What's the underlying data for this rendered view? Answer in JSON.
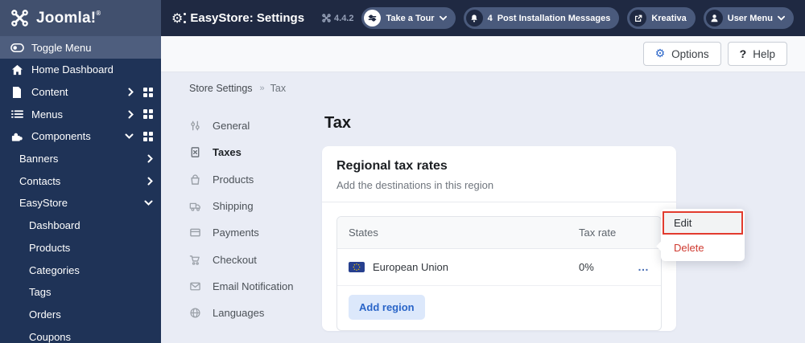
{
  "topbar": {
    "logo_text": "Joomla!",
    "logo_reg": "®",
    "app_title": "EasyStore: Settings",
    "version": "4.4.2",
    "take_a_tour": "Take a Tour",
    "messages_badge": "4",
    "messages_label": "Post Installation Messages",
    "template_name": "Kreativa",
    "user_menu": "User Menu"
  },
  "sidebar": {
    "items": [
      {
        "label": "Toggle Menu"
      },
      {
        "label": "Home Dashboard"
      },
      {
        "label": "Content"
      },
      {
        "label": "Menus"
      },
      {
        "label": "Components"
      },
      {
        "label": "Banners"
      },
      {
        "label": "Contacts"
      },
      {
        "label": "EasyStore"
      },
      {
        "label": "Dashboard"
      },
      {
        "label": "Products"
      },
      {
        "label": "Categories"
      },
      {
        "label": "Tags"
      },
      {
        "label": "Orders"
      },
      {
        "label": "Coupons"
      }
    ]
  },
  "toolbar": {
    "options": "Options",
    "help": "Help"
  },
  "breadcrumb": {
    "root": "Store Settings",
    "current": "Tax"
  },
  "settings_nav": {
    "items": [
      {
        "label": "General"
      },
      {
        "label": "Taxes"
      },
      {
        "label": "Products"
      },
      {
        "label": "Shipping"
      },
      {
        "label": "Payments"
      },
      {
        "label": "Checkout"
      },
      {
        "label": "Email Notification"
      },
      {
        "label": "Languages"
      }
    ]
  },
  "main": {
    "page_title": "Tax",
    "card": {
      "title": "Regional tax rates",
      "subtitle": "Add the destinations in this region",
      "columns": {
        "states": "States",
        "tax_rate": "Tax rate"
      },
      "rows": [
        {
          "state": "European Union",
          "tax_rate": "0%"
        }
      ],
      "add_region": "Add region",
      "row_menu_icon": "…"
    },
    "context_menu": {
      "edit": "Edit",
      "delete": "Delete"
    }
  },
  "colors": {
    "header_navy": "#1f2942",
    "sidebar_navy": "#1f3357",
    "pill_slate": "#4a5a7c",
    "accent_blue": "#2b66c9",
    "annotation_red": "#e23b2e",
    "delete_red": "#cf3a30",
    "add_region_bg": "#dce8fb",
    "content_bg": "#e9ecf5",
    "eu_flag_blue": "#27408f",
    "eu_star_gold": "#f5c400"
  }
}
